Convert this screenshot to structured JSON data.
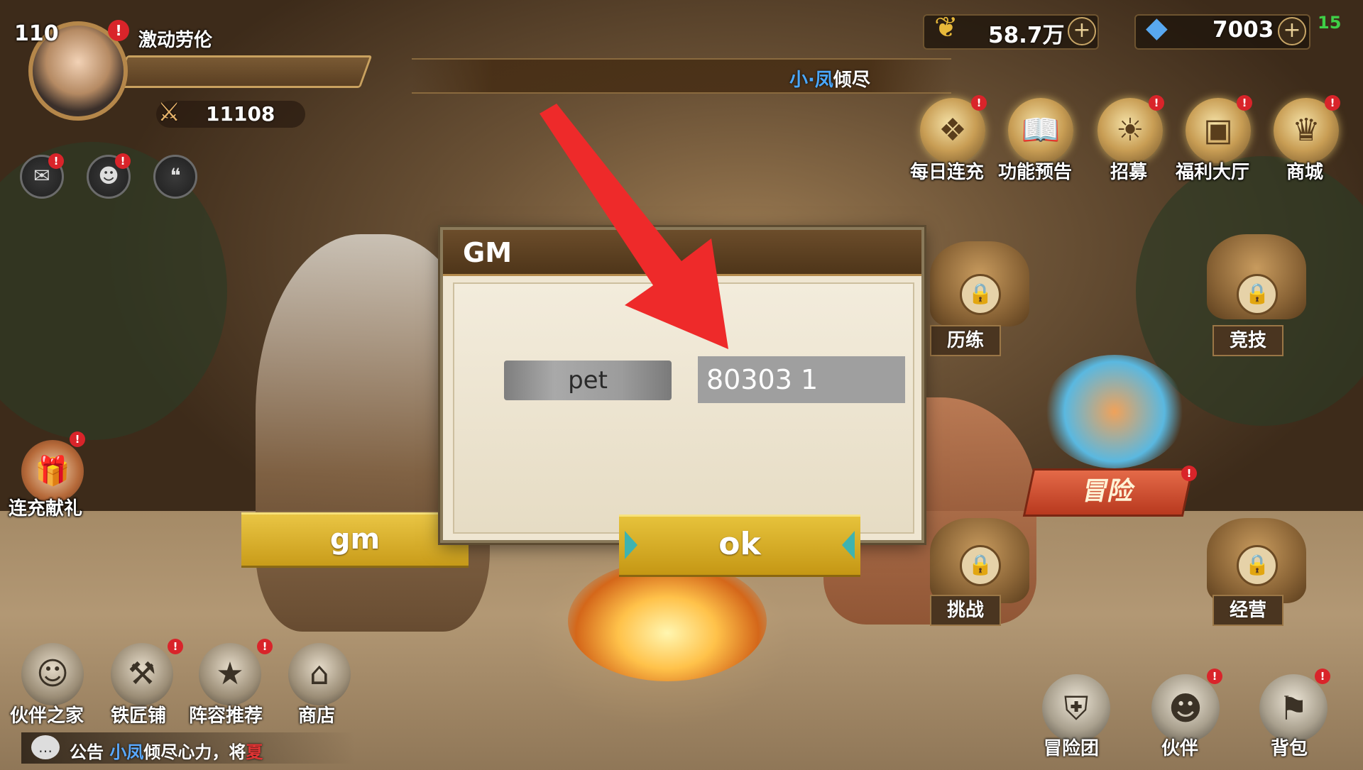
{
  "player": {
    "level": "110",
    "name": "激动劳伦",
    "power": "11108",
    "avatar_alert": "!"
  },
  "currencies": [
    {
      "icon": "gold-leaf-icon",
      "value": "58.7万",
      "color": "#e8b93a"
    },
    {
      "icon": "blue-crystal-icon",
      "value": "7003",
      "color": "#58a8f0"
    }
  ],
  "status": {
    "signal": "15"
  },
  "marquee": {
    "name": "小·凤",
    "text": "倾尽"
  },
  "top_features": [
    {
      "label": "每日连充",
      "icon": "crystal-emblem-icon"
    },
    {
      "label": "功能预告",
      "icon": "book-icon"
    },
    {
      "label": "招募",
      "icon": "sun-medallion-icon"
    },
    {
      "label": "福利大厅",
      "icon": "treasure-chest-icon"
    },
    {
      "label": "商城",
      "icon": "money-bag-icon"
    }
  ],
  "map_buildings": [
    {
      "label": "历练",
      "locked": true
    },
    {
      "label": "竞技",
      "locked": true
    },
    {
      "label": "冒险",
      "locked": false
    },
    {
      "label": "挑战",
      "locked": true
    },
    {
      "label": "经营",
      "locked": true
    }
  ],
  "left_event": {
    "label": "连充献礼"
  },
  "gm_button": {
    "label": "gm"
  },
  "dialog": {
    "title": "GM",
    "field_label": "pet",
    "input_value": "80303 1",
    "ok_label": "ok"
  },
  "bottom_left_nav": [
    {
      "label": "伙伴之家",
      "icon": "companion-home-icon"
    },
    {
      "label": "铁匠铺",
      "icon": "anvil-icon"
    },
    {
      "label": "阵容推荐",
      "icon": "star-formation-icon"
    },
    {
      "label": "商店",
      "icon": "shop-icon"
    }
  ],
  "announcement": {
    "prefix": "公告",
    "name": "小凤",
    "text": "倾尽心力，将",
    "highlight": "夏"
  },
  "bottom_right_nav": [
    {
      "label": "冒险团",
      "icon": "guild-shield-icon"
    },
    {
      "label": "伙伴",
      "icon": "companion-icon"
    },
    {
      "label": "背包",
      "icon": "backpack-icon"
    }
  ],
  "colors": {
    "accent_gold": "#d9b22e",
    "alert_red": "#d9242a",
    "dialog_bg": "#efe6d2",
    "arrow_red": "#ee2a2a"
  }
}
